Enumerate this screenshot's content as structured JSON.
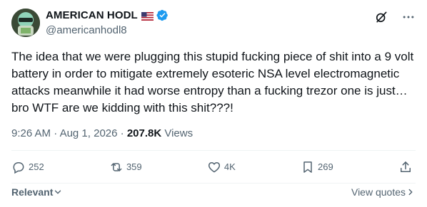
{
  "author": {
    "display_name": "AMERICAN HODL",
    "handle": "@americanhodl8",
    "flag_icon": "us-flag-icon",
    "verified_icon": "verified-badge-icon",
    "verified_color": "#1d9bf0"
  },
  "header_actions": {
    "grok_icon": "grok-icon",
    "more_icon": "more-dots-icon"
  },
  "tweet": {
    "text": "The idea that we were plugging this stupid fucking piece of shit into a 9 volt battery in order to mitigate extremely esoteric NSA level electromagnetic attacks meanwhile it had worse entropy than a fucking trezor one is just… bro WTF are we kidding with this shit???!"
  },
  "meta": {
    "time": "9:26 AM",
    "separator": "·",
    "date": "Aug 1, 2026",
    "views_count": "207.8K",
    "views_label": "Views"
  },
  "actions": {
    "replies": "252",
    "reposts": "359",
    "likes": "4K",
    "bookmarks": "269"
  },
  "footer": {
    "sort_label": "Relevant",
    "view_quotes": "View quotes"
  },
  "colors": {
    "text": "#0f1419",
    "secondary": "#536471",
    "divider": "#eff3f4"
  }
}
